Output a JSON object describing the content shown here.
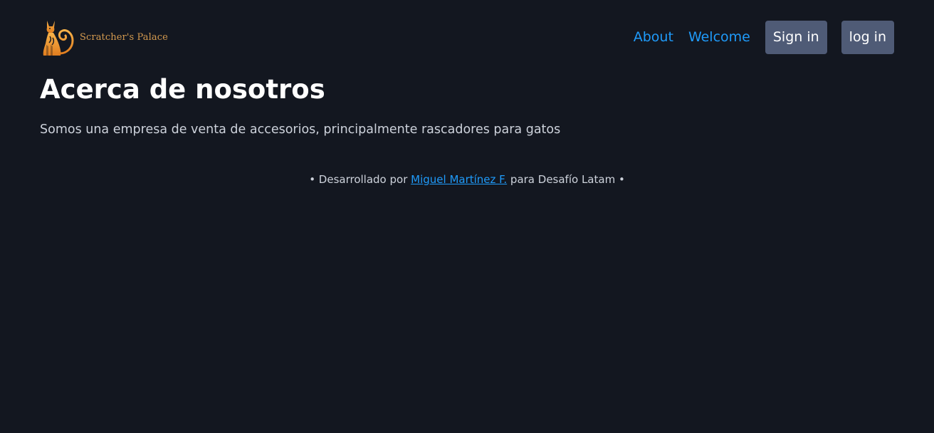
{
  "brand": {
    "name": "Scratcher's Palace",
    "logo_icon": "cat-logo-icon",
    "logo_color": "#f2a23a"
  },
  "nav": {
    "about_label": "About",
    "welcome_label": "Welcome",
    "signin_label": "Sign in",
    "login_label": "log in"
  },
  "main": {
    "title": "Acerca de nosotros",
    "description": "Somos una empresa de venta de accesorios, principalmente rascadores para gatos"
  },
  "footer": {
    "prefix": "• Desarrollado por ",
    "author_link": "Miguel Martínez F.",
    "suffix": " para Desafío Latam •"
  },
  "colors": {
    "background": "#131720",
    "link": "#1f9bfa",
    "button_bg": "#4f5b76",
    "brand_text": "#d49a4f"
  }
}
